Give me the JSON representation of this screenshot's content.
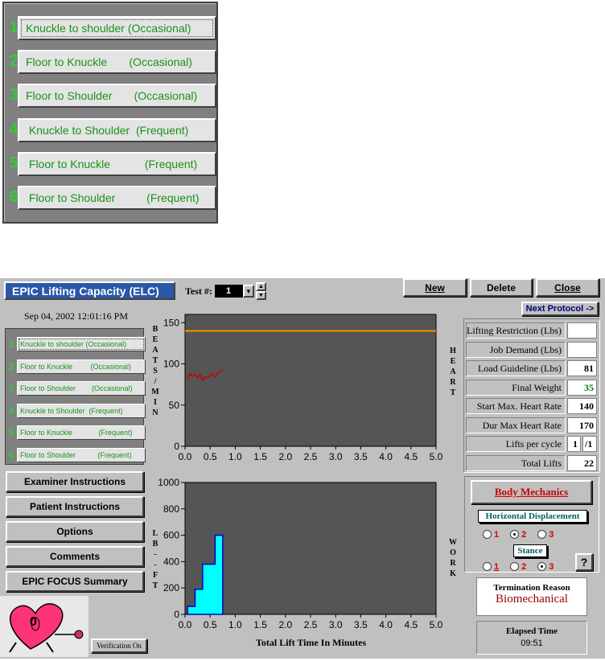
{
  "zoom_panel": {
    "items": [
      {
        "num": "1",
        "label": "Knuckle to shoulder (Occasional)"
      },
      {
        "num": "2",
        "label": "Floor to Knuckle       (Occasional)"
      },
      {
        "num": "3",
        "label": "Floor to Shoulder       (Occasional)"
      },
      {
        "num": "4",
        "label": " Knuckle to Shoulder  (Frequent)"
      },
      {
        "num": "5",
        "label": " Floor to Knuckle           (Frequent)"
      },
      {
        "num": "6",
        "label": " Floor to Shoulder          (Frequent)"
      }
    ]
  },
  "window": {
    "title": "EPIC Lifting Capacity (ELC)",
    "test_label": "Test #:",
    "test_value": "1",
    "new_label": "New",
    "delete_label": "Delete",
    "close_label": "Close",
    "next_protocol_label": "Next Protocol ->",
    "datetime": "Sep 04, 2002 12:01:16 PM"
  },
  "protocols": [
    {
      "num": "1",
      "label": "Knuckle to shoulder (Occasional)"
    },
    {
      "num": "2",
      "label": "Floor to Knuckle         (Occasional)"
    },
    {
      "num": "3",
      "label": "Floor to Shoulder        (Occasional)"
    },
    {
      "num": "4",
      "label": "Knuckle to Shoulder  (Frequent)"
    },
    {
      "num": "5",
      "label": "Floor to Knuckle             (Frequent)"
    },
    {
      "num": "6",
      "label": "Floor to Shoulder           (Frequent)"
    }
  ],
  "left_buttons": {
    "examiner": "Examiner Instructions",
    "patient": "Patient Instructions",
    "options": "Options",
    "comments": "Comments",
    "focus": "EPIC FOCUS Summary",
    "verification": "Verification On"
  },
  "heart_icon_value": "0",
  "labels": {
    "bpm": [
      "B",
      "E",
      "A",
      "T",
      "S",
      "/",
      "M",
      "I",
      "N"
    ],
    "lbft": [
      "L",
      "B",
      "-",
      "-",
      "F",
      "T"
    ],
    "heart": [
      "H",
      "E",
      "A",
      "R",
      "T"
    ],
    "work": [
      "W",
      "O",
      "R",
      "K"
    ],
    "x_title": "Total Lift Time In Minutes"
  },
  "metrics": [
    {
      "label": "Lifting Restriction (Lbs)",
      "value": ""
    },
    {
      "label": "Job Demand (Lbs)",
      "value": ""
    },
    {
      "label": "Load Guideline (Lbs)",
      "value": "81"
    },
    {
      "label": "Final Weight",
      "value": "35",
      "color": "#008000"
    },
    {
      "label": "Start Max. Heart Rate",
      "value": "140"
    },
    {
      "label": "Dur Max Heart Rate",
      "value": "170"
    },
    {
      "label": "Lifts per cycle",
      "value": "1",
      "value2": "/1"
    },
    {
      "label": "Total Lifts",
      "value": "22"
    }
  ],
  "body_mechanics": {
    "title": "Body Mechanics",
    "horizontal_label": "Horizontal  Displacement",
    "stance_label": "Stance",
    "horizontal_options": [
      "1",
      "2",
      "3"
    ],
    "horizontal_selected": "2",
    "stance_options": [
      "1",
      "2",
      "3"
    ],
    "stance_selected": "3",
    "help": "?"
  },
  "termination": {
    "label": "Termination Reason",
    "value": "Biomechanical"
  },
  "elapsed": {
    "label": "Elapsed Time",
    "value": "09:51"
  },
  "colors": {
    "plot_bg": "#555555",
    "heart_line": "#ff8c00",
    "heart_trace": "#cc0000",
    "work_fill": "#00ffff",
    "work_edge": "#0000cc"
  },
  "chart_data": [
    {
      "type": "line",
      "ylabel": "BEATS/MIN",
      "xlabel": "Total Lift Time In Minutes",
      "xlim": [
        0,
        5
      ],
      "ylim": [
        0,
        160
      ],
      "x_ticks": [
        "0.0",
        "0.5",
        "1.0",
        "1.5",
        "2.0",
        "2.5",
        "3.0",
        "3.5",
        "4.0",
        "4.5",
        "5.0"
      ],
      "y_ticks": [
        "0",
        "50",
        "100",
        "150"
      ],
      "series": [
        {
          "x": [
            0.05,
            0.1,
            0.15,
            0.2,
            0.25,
            0.3,
            0.35,
            0.4,
            0.45,
            0.5,
            0.55,
            0.6,
            0.65,
            0.7,
            0.75
          ],
          "y": [
            82,
            88,
            85,
            88,
            83,
            87,
            80,
            84,
            83,
            86,
            88,
            84,
            89,
            91,
            93
          ]
        },
        {
          "x": [
            0,
            5
          ],
          "y": [
            140,
            140
          ]
        }
      ]
    },
    {
      "type": "area",
      "ylabel": "LB--FT",
      "xlabel": "Total Lift Time In Minutes",
      "xlim": [
        0,
        5
      ],
      "ylim": [
        0,
        1000
      ],
      "x_ticks": [
        "0.0",
        "0.5",
        "1.0",
        "1.5",
        "2.0",
        "2.5",
        "3.0",
        "3.5",
        "4.0",
        "4.5",
        "5.0"
      ],
      "y_ticks": [
        "0",
        "200",
        "400",
        "600",
        "800",
        "1000"
      ],
      "series": [
        {
          "x": [
            0.05,
            0.2,
            0.2,
            0.35,
            0.35,
            0.6,
            0.6,
            0.75,
            0.75
          ],
          "y": [
            60,
            60,
            190,
            190,
            380,
            380,
            600,
            600,
            0
          ]
        }
      ]
    }
  ]
}
